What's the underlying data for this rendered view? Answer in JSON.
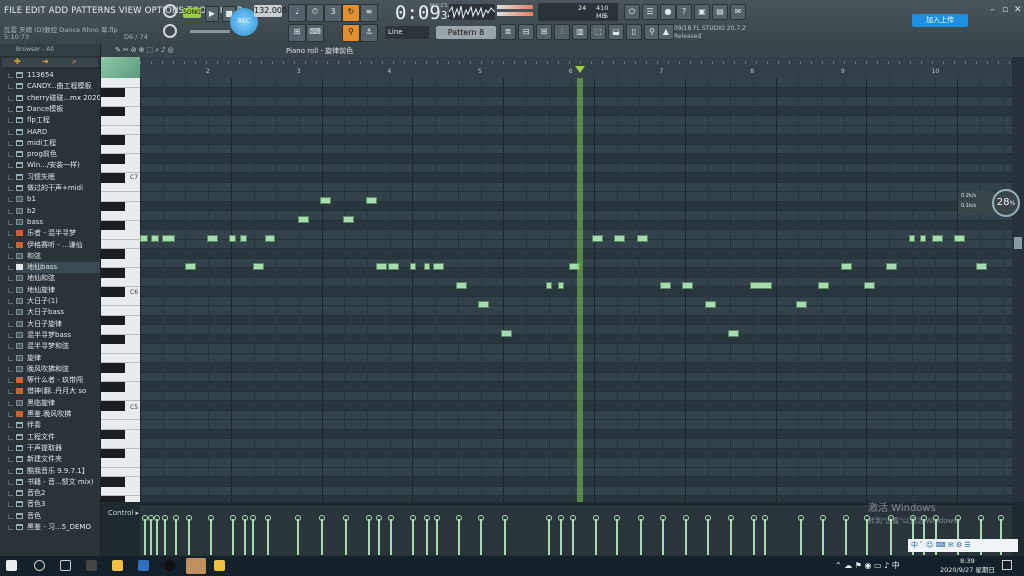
{
  "menu": [
    "FILE",
    "EDIT",
    "ADD",
    "PATTERNS",
    "VIEW",
    "OPTIONS",
    "TOOLS",
    "HELP"
  ],
  "song_file": "乱雲 天晴 (D)数控 Dance Rhno 草.flp",
  "position": "5:10:73",
  "position_right": "D6 / 74",
  "transport": {
    "song_label": "SONG",
    "tempo": "132.000",
    "time": "0:09",
    "time_frac": "34",
    "time_label": "M:S:CS",
    "rec_label": "REC"
  },
  "memory": {
    "value1": "24",
    "value2": "410 MB",
    "value3": "5"
  },
  "snap": "Line",
  "pattern": "Pattern 8",
  "fl_info": {
    "line1": "09/18  FL STUDIO 20.7.2",
    "line2": "Released"
  },
  "share_label": "加入上传",
  "browser_label": "Browser - All",
  "piano_roll_title": "Piano roll - 旋律前色",
  "sidebar_items": [
    {
      "label": "113654",
      "icon": "folder"
    },
    {
      "label": "CANDY...曲工程模板",
      "icon": "folder"
    },
    {
      "label": "cherry碰碰...mx 2020)",
      "icon": "folder"
    },
    {
      "label": "Dance模板",
      "icon": "folder"
    },
    {
      "label": "flp工程",
      "icon": "folder"
    },
    {
      "label": "HARD",
      "icon": "folder"
    },
    {
      "label": "midi工程",
      "icon": "folder"
    },
    {
      "label": "prog前色",
      "icon": "folder"
    },
    {
      "label": "Win.../安装一样)",
      "icon": "folder"
    },
    {
      "label": "习惯失眠",
      "icon": "folder"
    },
    {
      "label": "做过的干声+midi",
      "icon": "folder"
    },
    {
      "label": "b1",
      "icon": "file"
    },
    {
      "label": "b2",
      "icon": "file"
    },
    {
      "label": "bass",
      "icon": "file"
    },
    {
      "label": "乐者 - 混半寻梦",
      "icon": "audio"
    },
    {
      "label": "伊格赛听 - ...谦仙",
      "icon": "audio"
    },
    {
      "label": "和弦",
      "icon": "file"
    },
    {
      "label": "地仙bass",
      "icon": "midi"
    },
    {
      "label": "地仙和弦",
      "icon": "file"
    },
    {
      "label": "地仙旋律",
      "icon": "file"
    },
    {
      "label": "大日子(1)",
      "icon": "file"
    },
    {
      "label": "大日子bass",
      "icon": "file"
    },
    {
      "label": "大日子旋律",
      "icon": "file"
    },
    {
      "label": "混半寻梦bass",
      "icon": "file"
    },
    {
      "label": "混半寻梦和弦",
      "icon": "file"
    },
    {
      "label": "旋律",
      "icon": "file"
    },
    {
      "label": "晚风吹拂和弦",
      "icon": "file"
    },
    {
      "label": "等什么者 - 玖带闯",
      "icon": "audio"
    },
    {
      "label": "借神(翻..丹月大 so",
      "icon": "audio"
    },
    {
      "label": "黑临旋律",
      "icon": "file"
    },
    {
      "label": "黑鉴.晚风吹拂",
      "icon": "audio"
    },
    {
      "label": "伴奏",
      "icon": "folder"
    },
    {
      "label": "工程文件",
      "icon": "folder"
    },
    {
      "label": "干声提取器",
      "icon": "folder"
    },
    {
      "label": "新建文件夹",
      "icon": "folder"
    },
    {
      "label": "酷我音乐 9.9.7.1】",
      "icon": "folder"
    },
    {
      "label": "书籍 - 音...惯文 mix)",
      "icon": "folder"
    },
    {
      "label": "音色2",
      "icon": "folder"
    },
    {
      "label": "音色3",
      "icon": "folder"
    },
    {
      "label": "音色",
      "icon": "folder"
    },
    {
      "label": "黑鉴 - 习...5_DEMO",
      "icon": "folder"
    }
  ],
  "timeline_bars": [
    "2",
    "3",
    "4",
    "5",
    "6",
    "7",
    "8",
    "9",
    "10"
  ],
  "octave_labels": [
    "C7",
    "C6",
    "C5"
  ],
  "cpu": {
    "percent": "28",
    "line1": "0.2k/s",
    "line2": "0.1k/s"
  },
  "control_label": "Control",
  "watermark": {
    "line1": "激活 Windows",
    "line2": "转到\"设置\"以激活 Windows。"
  },
  "ime_text": "中 ﾟ ☺ ⌨ ✉ ⚙ ☰",
  "clock": {
    "time": "8:39",
    "date": "2020/9/27 星期日"
  },
  "colors": {
    "accent": "#e09030",
    "note": "#a8dcb0",
    "playhead": "#78c850",
    "share": "#1e90e0"
  }
}
